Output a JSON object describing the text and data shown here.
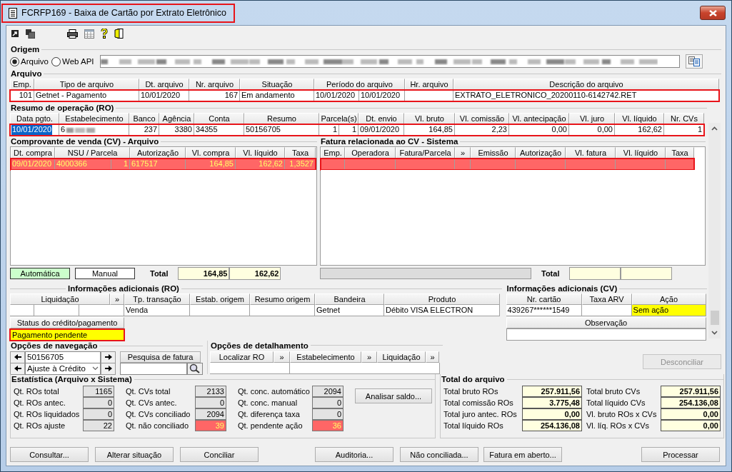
{
  "window": {
    "title": "FCRFP169 - Baixa de Cartão por Extrato Eletrônico",
    "highlighted": true
  },
  "origem": {
    "title": "Origem",
    "options": [
      {
        "label": "Arquivo",
        "selected": true
      },
      {
        "label": "Web API",
        "selected": false
      }
    ]
  },
  "arquivo": {
    "title": "Arquivo",
    "columns": [
      "Emp.",
      "Tipo de arquivo",
      "Dt. arquivo",
      "Nr. arquivo",
      "Situação",
      "Período do arquivo",
      null,
      "Hr. arquivo",
      "Descrição do arquivo"
    ],
    "rows": [
      {
        "highlighted": true,
        "cells": [
          "101",
          "Getnet - Pagamento",
          "10/01/2020",
          "167",
          "Em andamento",
          "10/01/2020",
          "10/01/2020",
          null,
          "EXTRATO_ELETRONICO_20200110-6142742.RET"
        ]
      }
    ]
  },
  "resumo": {
    "title": "Resumo de operação (RO)",
    "columns": [
      "Data pgto.",
      "Estabelecimento",
      "Banco",
      "Agência",
      "Conta",
      "Resumo",
      "Parcela(s)",
      null,
      "Dt. envio",
      "Vl. bruto",
      "Vl. comissão",
      "Vl. antecipação",
      "Vl. juro",
      "Vl. líquido",
      "Nr. CVs"
    ],
    "rows": [
      {
        "highlighted": true,
        "cells": [
          {
            "text": "10/01/2020",
            "selected": true
          },
          {
            "text": "6",
            "selected": false
          },
          {
            "text": "237",
            "selected": false
          },
          {
            "text": "3380",
            "selected": false
          },
          {
            "text": "34355",
            "selected": false
          },
          {
            "text": "50156705",
            "selected": false
          },
          {
            "text": "1",
            "selected": false
          },
          {
            "text": "1",
            "selected": false
          },
          {
            "text": "09/01/2020",
            "selected": false
          },
          {
            "text": "164,85",
            "selected": false
          },
          {
            "text": "2,23",
            "selected": false
          },
          {
            "text": "0,00",
            "selected": false
          },
          {
            "text": "0,00",
            "selected": false
          },
          {
            "text": "162,62",
            "selected": false
          },
          {
            "text": "1",
            "selected": false
          }
        ]
      }
    ]
  },
  "cv_arquivo": {
    "title": "Comprovante de venda (CV) - Arquivo",
    "columns": [
      "Dt. compra",
      "NSU / Parcela",
      null,
      "Autorização",
      "Vl. compra",
      "Vl. líquido",
      "Taxa"
    ],
    "rows": [
      {
        "color": "#ff6666",
        "highlighted": true,
        "cells": [
          "09/01/2020",
          "4000366",
          "1",
          "617517",
          "164,85",
          "162,62",
          "1,3527"
        ]
      }
    ],
    "legend": [
      {
        "label": "Automática",
        "color": "#ccffcc"
      },
      {
        "label": "Manual",
        "color": "#ffffff"
      }
    ],
    "total_label": "Total",
    "totals": [
      "164,85",
      "162,62"
    ]
  },
  "fatura": {
    "title": "Fatura relacionada ao CV - Sistema",
    "columns": [
      "Emp.",
      "Operadora",
      "Fatura/Parcela",
      "»",
      "Emissão",
      "Autorização",
      "Vl. fatura",
      "Vl. líquido",
      "Taxa"
    ],
    "rows": [
      {
        "color": "#ff6666",
        "highlighted": true
      }
    ],
    "total_label": "Total"
  },
  "info_ro": {
    "title": "Informações adicionais (RO)",
    "columns": [
      "Liquidação",
      null,
      null,
      "»",
      "Tp. transação",
      "Estab. origem",
      "Resumo origem",
      "Bandeira",
      "Produto"
    ],
    "cells": [
      null,
      null,
      null,
      "Venda",
      null,
      null,
      "Getnet",
      "Débito VISA ELECTRON"
    ],
    "status": {
      "label": "Status do crédito/pagamento",
      "value": "Pagamento pendente",
      "alert": true,
      "highlighted": true
    }
  },
  "info_cv": {
    "title": "Informações adicionais (CV)",
    "columns": [
      "Nr. cartão",
      "Taxa ARV",
      "Ação"
    ],
    "cells": [
      {
        "text": "439267******1549",
        "alert": false
      },
      {
        "alert": false
      },
      {
        "text": "Sem ação",
        "alert": true
      }
    ],
    "observacao_label": "Observação"
  },
  "navegacao": {
    "title": "Opções de navegação",
    "resumo": "50156705",
    "tipo": "Ajuste à Crédito",
    "search_button": "Pesquisa de fatura"
  },
  "detalhamento": {
    "title": "Opções de detalhamento",
    "columns": [
      "Localizar RO",
      "»",
      "Estabelecimento",
      "»",
      "Liquidação",
      "»"
    ]
  },
  "desconciliar": {
    "label": "Desconciliar",
    "disabled": true
  },
  "estatistica": {
    "title": "Estatística (Arquivo x Sistema)",
    "button": "Analisar saldo...",
    "items": [
      {
        "label": "Qt. ROs total",
        "value": "1165",
        "alert": false
      },
      {
        "label": "Qt. ROs antec.",
        "value": "0",
        "alert": false
      },
      {
        "label": "Qt. ROs liquidados",
        "value": "0",
        "alert": false
      },
      {
        "label": "Qt. ROs ajuste",
        "value": "22",
        "alert": false
      },
      {
        "label": "Qt. CVs total",
        "value": "2133",
        "alert": false
      },
      {
        "label": "Qt. CVs antec.",
        "value": "0",
        "alert": false
      },
      {
        "label": "Qt. CVs conciliado",
        "value": "2094",
        "alert": false
      },
      {
        "label": "Qt. não conciliado",
        "value": "39",
        "alert": true
      },
      {
        "label": "Qt. conc. automático",
        "value": "2094",
        "alert": false
      },
      {
        "label": "Qt. conc. manual",
        "value": "0",
        "alert": false
      },
      {
        "label": "Qt. diferença taxa",
        "value": "0",
        "alert": false
      },
      {
        "label": "Qt. pendente ação",
        "value": "36",
        "alert": true
      }
    ]
  },
  "total_arquivo": {
    "title": "Total do arquivo",
    "items": [
      {
        "label": "Total bruto ROs",
        "value": "257.911,56"
      },
      {
        "label": "Total comissão ROs",
        "value": "3.775,48"
      },
      {
        "label": "Total juro antec. ROs",
        "value": "0,00"
      },
      {
        "label": "Total líquido ROs",
        "value": "254.136,08"
      },
      {
        "label": "Total bruto CVs",
        "value": "257.911,56"
      },
      {
        "label": "Total líquido CVs",
        "value": "254.136,08"
      },
      {
        "label": "Vl. bruto ROs x CVs",
        "value": "0,00"
      },
      {
        "label": "Vl. líq. ROs x CVs",
        "value": "0,00"
      }
    ]
  },
  "buttons": [
    "Consultar...",
    "Alterar situação",
    "Conciliar",
    "Auditoria...",
    "Não conciliada...",
    "Fatura em aberto...",
    "Processar"
  ]
}
